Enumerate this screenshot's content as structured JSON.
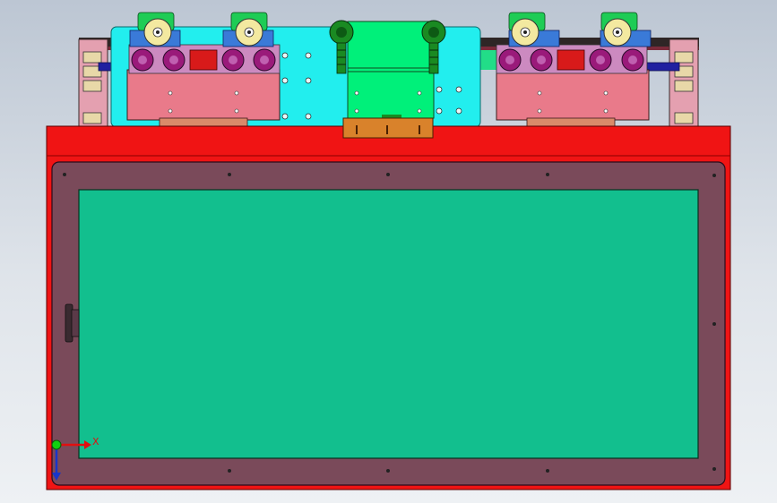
{
  "viewport": {
    "background_top": "#bcc6d3",
    "background_bottom": "#eef1f4"
  },
  "colors": {
    "frame_red": "#f01414",
    "pocket_maroon": "#7a4a5a",
    "plate_green": "#12bf8e",
    "back_plate_cyan": "#22eeee",
    "center_block_green": "#00f07a",
    "slide_pink": "#e97a8a",
    "roller_purple": "#9a1a7a",
    "clamp_blue": "#3a7ad8",
    "knob_green": "#1ecc55",
    "knob_yellow": "#f3e9a0",
    "fitting_green": "#1a8a22",
    "bracket_orange": "#d9822b",
    "rail_navy": "#2020a0",
    "end_block_pink": "#e4a0b0"
  },
  "triad": {
    "x_label": "X",
    "x_axis_color": "#e01010",
    "y_axis_color": "#1a36c8",
    "origin_color": "#10d010"
  }
}
